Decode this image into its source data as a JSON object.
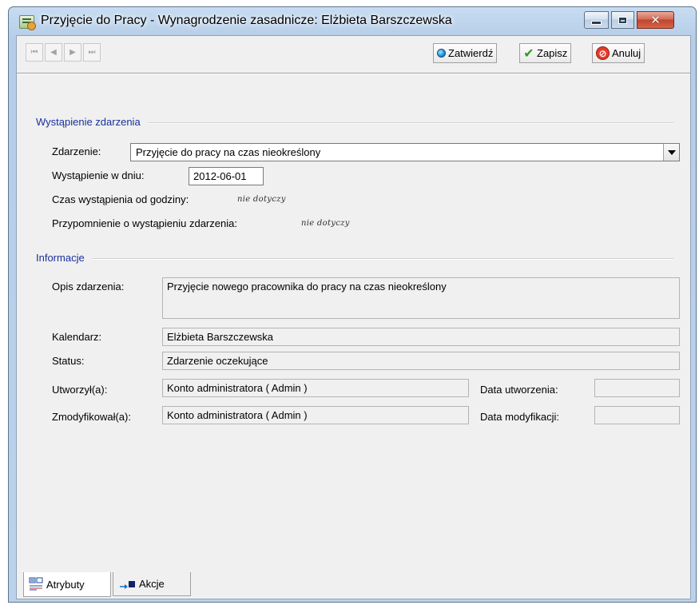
{
  "window": {
    "title": "Przyjęcie do Pracy - Wynagrodzenie zasadnicze:  Elżbieta Barszczewska",
    "close_glyph": "✕"
  },
  "toolbar": {
    "first_glyph": "⏮",
    "prev_glyph": "◀",
    "next_glyph": "▶",
    "last_glyph": "⏭",
    "confirm_label": "Zatwierdź",
    "save_label": "Zapisz",
    "cancel_label": "Anuluj"
  },
  "occurrence": {
    "section_title": "Wystąpienie zdarzenia",
    "event_label": "Zdarzenie:",
    "event_value": "Przyjęcie do pracy na czas nieokreślony",
    "date_label": "Wystąpienie w dniu:",
    "date_value": "2012-06-01",
    "time_label": "Czas wystąpienia od godziny:",
    "time_value": "nie dotyczy",
    "reminder_label": "Przypomnienie o wystąpieniu zdarzenia:",
    "reminder_value": "nie dotyczy"
  },
  "info": {
    "section_title": "Informacje",
    "description_label": "Opis zdarzenia:",
    "description_value": "Przyjęcie nowego pracownika do pracy na czas nieokreślony",
    "calendar_label": "Kalendarz:",
    "calendar_value": "Elżbieta Barszczewska",
    "status_label": "Status:",
    "status_value": "Zdarzenie oczekujące",
    "created_by_label": "Utworzył(a):",
    "created_by_value": "Konto administratora ( Admin )",
    "created_date_label": "Data utworzenia:",
    "created_date_value": "",
    "modified_by_label": "Zmodyfikował(a):",
    "modified_by_value": "Konto administratora ( Admin )",
    "modified_date_label": "Data modyfikacji:",
    "modified_date_value": ""
  },
  "tabs": [
    {
      "label": "Atrybuty",
      "active": true,
      "icon": "attributes-icon"
    },
    {
      "label": "Akcje",
      "active": false,
      "icon": "actions-icon"
    }
  ],
  "colors": {
    "section_title": "#1a2f9c",
    "close_button": "#c1442a"
  }
}
